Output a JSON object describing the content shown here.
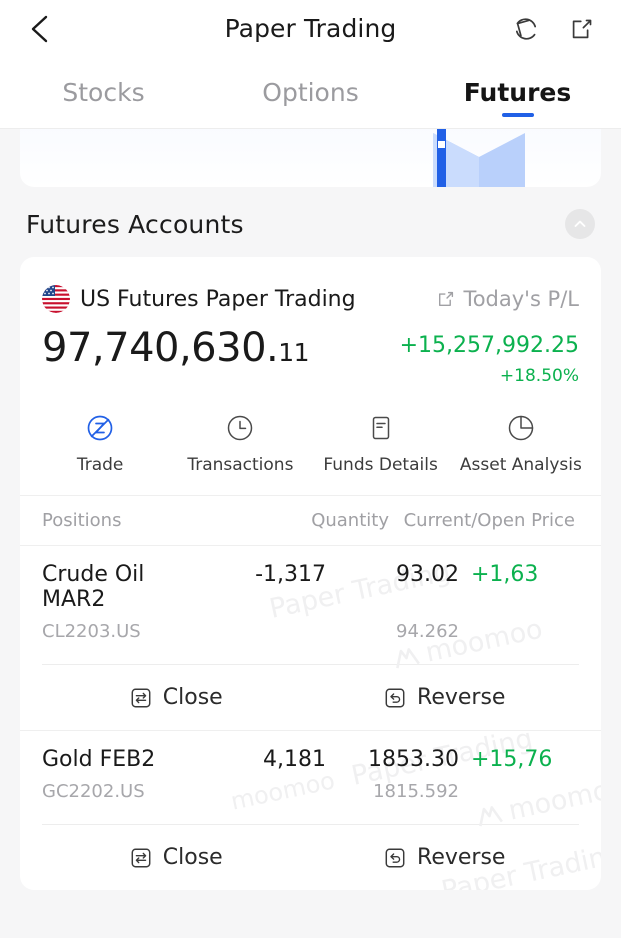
{
  "nav": {
    "back_icon": "chevron-left-icon",
    "title": "Paper Trading",
    "refresh_icon": "refresh-icon",
    "share_icon": "share-icon"
  },
  "tabs": [
    {
      "label": "Stocks",
      "active": false
    },
    {
      "label": "Options",
      "active": false
    },
    {
      "label": "Futures",
      "active": true
    }
  ],
  "section": {
    "title": "Futures Accounts",
    "collapse_icon": "chevron-up-icon"
  },
  "account": {
    "flag_icon": "us-flag-icon",
    "name": "US Futures Paper Trading",
    "todays_pl_label": "Today's P/L",
    "todays_pl_share_icon": "share-icon",
    "balance_main": "97,740,630.",
    "balance_cents": "11",
    "pl_amount": "+15,257,992.25",
    "pl_percent": "+18.50%"
  },
  "actions": [
    {
      "label": "Trade",
      "icon": "trade-icon"
    },
    {
      "label": "Transactions",
      "icon": "clock-icon"
    },
    {
      "label": "Funds Details",
      "icon": "document-icon"
    },
    {
      "label": "Asset Analysis",
      "icon": "pie-chart-icon"
    }
  ],
  "positions_header": {
    "name": "Positions",
    "quantity": "Quantity",
    "price": "Current/Open Price"
  },
  "positions": [
    {
      "name": "Crude Oil MAR2",
      "code": "CL2203.US",
      "quantity": "-1,317",
      "current_price": "93.02",
      "open_price": "94.262",
      "pl": "+1,63",
      "close_label": "Close",
      "reverse_label": "Reverse"
    },
    {
      "name": "Gold FEB2",
      "code": "GC2202.US",
      "quantity": "4,181",
      "current_price": "1853.30",
      "open_price": "1815.592",
      "pl": "+15,76",
      "close_label": "Close",
      "reverse_label": "Reverse"
    }
  ],
  "watermarks": {
    "text": "Paper Trading",
    "brand": "moomoo"
  },
  "colors": {
    "accent": "#2160e6",
    "positive": "#0bb14e",
    "background": "#f6f6f7",
    "card": "#ffffff"
  }
}
